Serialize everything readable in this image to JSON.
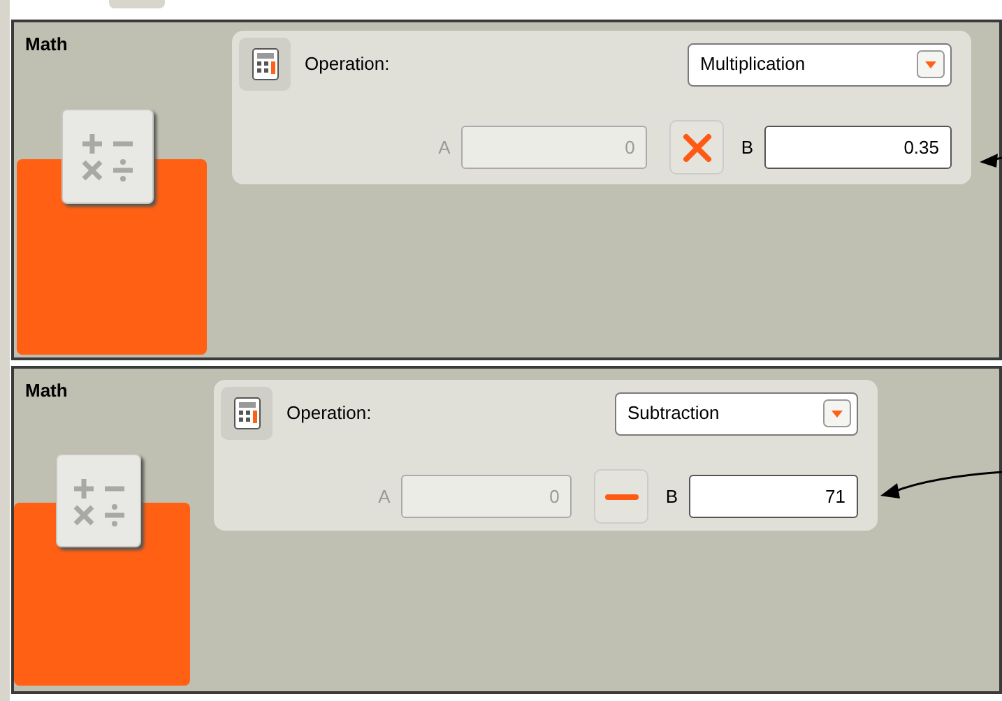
{
  "blocks": [
    {
      "title": "Math",
      "operation_label": "Operation:",
      "operation": "Multiplication",
      "kind": "multiply",
      "a_label": "A",
      "a_value": "0",
      "a_disabled": true,
      "b_label": "B",
      "b_value": "0.35"
    },
    {
      "title": "Math",
      "operation_label": "Operation:",
      "operation": "Subtraction",
      "kind": "subtract",
      "a_label": "A",
      "a_value": "0",
      "a_disabled": true,
      "b_label": "B",
      "b_value": "71"
    }
  ]
}
